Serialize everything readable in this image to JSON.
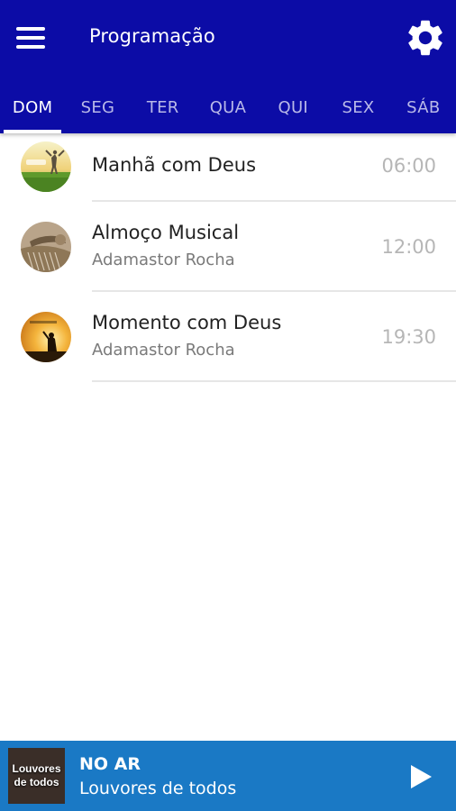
{
  "appbar": {
    "title": "Programação",
    "menu_icon": "hamburger-menu-icon",
    "settings_icon": "gear-icon",
    "background": "#0c0ca6"
  },
  "tabs": [
    {
      "label": "DOM",
      "active": true
    },
    {
      "label": "SEG",
      "active": false
    },
    {
      "label": "TER",
      "active": false
    },
    {
      "label": "QUA",
      "active": false
    },
    {
      "label": "QUI",
      "active": false
    },
    {
      "label": "SEX",
      "active": false
    },
    {
      "label": "SÁB",
      "active": false
    }
  ],
  "schedule": [
    {
      "name": "Manhã com Deus",
      "host": "",
      "time": "06:00"
    },
    {
      "name": "Almoço Musical",
      "host": "Adamastor Rocha",
      "time": "12:00"
    },
    {
      "name": "Momento com Deus",
      "host": "Adamastor Rocha",
      "time": "19:30"
    }
  ],
  "player": {
    "status": "NO AR",
    "show": "Louvores de todos",
    "thumb_text": "Louvores de todos",
    "play_icon": "play-icon",
    "background": "#1a79c5"
  }
}
